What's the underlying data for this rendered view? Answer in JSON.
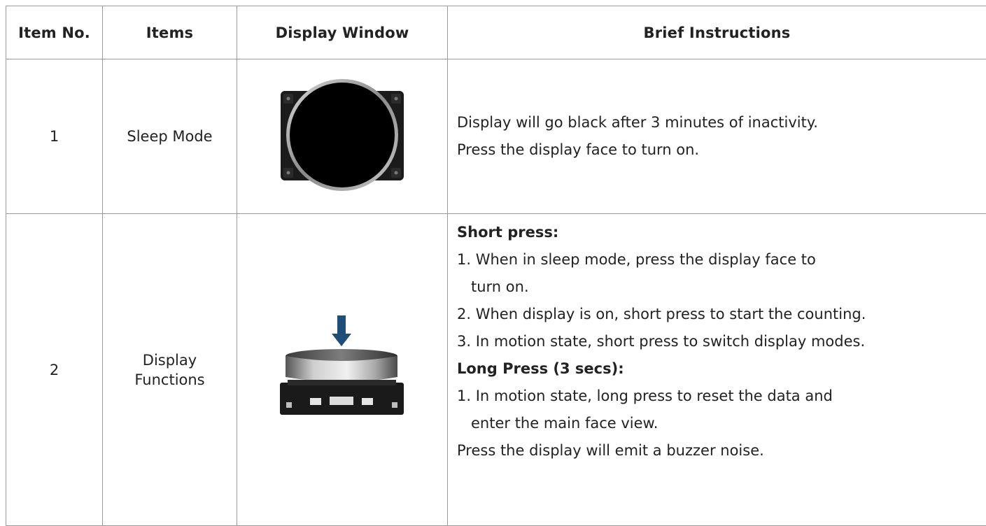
{
  "table": {
    "headers": {
      "item_no": "Item No.",
      "items": "Items",
      "display_window": "Display Window",
      "brief_instructions": "Brief Instructions"
    },
    "rows": [
      {
        "item_no": "1",
        "items": "Sleep Mode",
        "display_icon": "round-display-face-icon",
        "instructions": [
          "Display will go black after 3 minutes of inactivity.",
          "Press the display face to turn on."
        ]
      },
      {
        "item_no": "2",
        "items_line1": "Display",
        "items_line2": "Functions",
        "display_icon": "press-down-button-icon",
        "instructions": {
          "short_press_heading": "Short press:",
          "short_1a": "1.  When in sleep mode, press the display face to",
          "short_1b": "turn on.",
          "short_2": "2. When display is on, short press to start the counting.",
          "short_3": "3. In motion state, short press to switch display modes.",
          "long_press_heading": "Long Press (3 secs):",
          "long_1a": "1.  In motion state, long press to reset the data and",
          "long_1b": "enter the main face view.",
          "note": "Press the display will emit a buzzer noise."
        }
      }
    ]
  },
  "colors": {
    "border": "#9a9a9a",
    "text": "#222222",
    "arrow": "#1f4e79"
  }
}
